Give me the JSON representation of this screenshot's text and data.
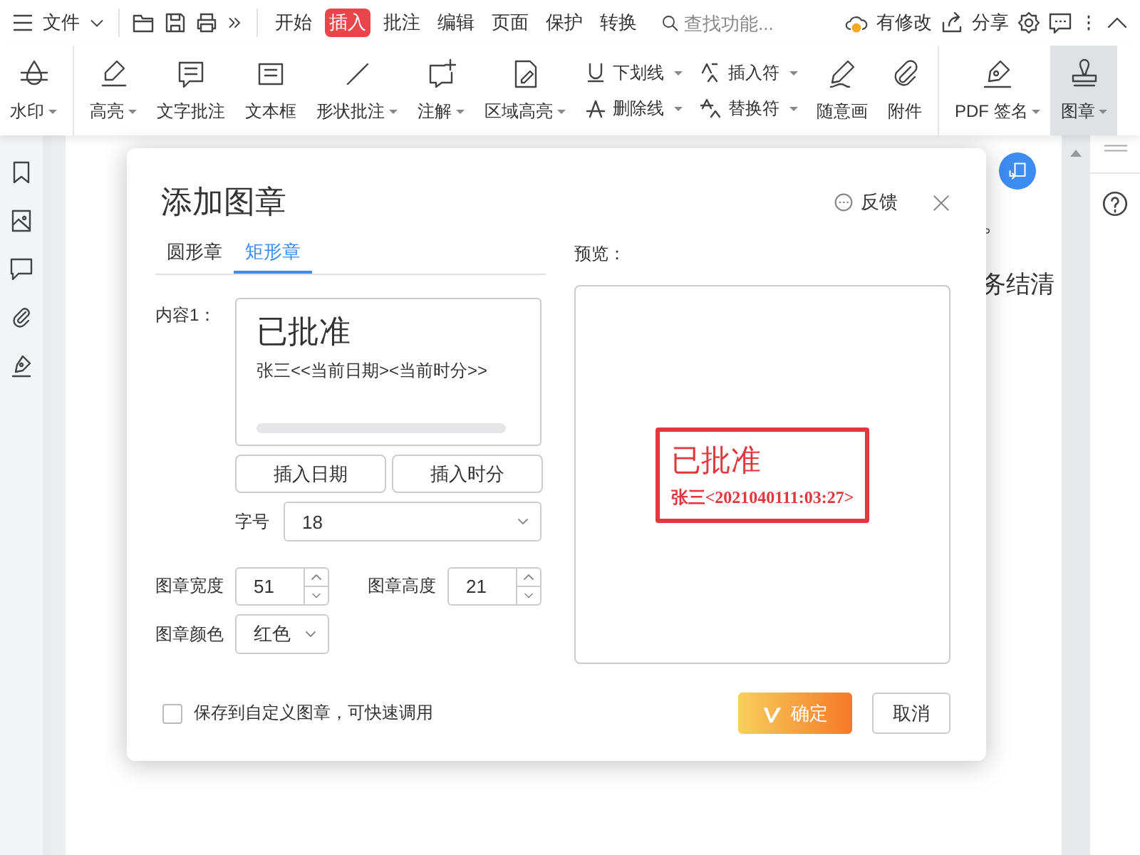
{
  "menubar": {
    "file_menu": "文件",
    "tabs": [
      {
        "label": "开始",
        "selected": false
      },
      {
        "label": "插入",
        "selected": true
      },
      {
        "label": "批注",
        "selected": false
      },
      {
        "label": "编辑",
        "selected": false
      },
      {
        "label": "页面",
        "selected": false
      },
      {
        "label": "保护",
        "selected": false
      },
      {
        "label": "转换",
        "selected": false
      }
    ],
    "search": {
      "placeholder": "查找功能..."
    },
    "sync_status": "有修改",
    "share": "分享"
  },
  "ribbon": {
    "groups": [
      [
        {
          "kind": "big",
          "label": "水印",
          "dropdown": true,
          "selected": false
        }
      ],
      [
        {
          "kind": "big",
          "label": "高亮",
          "dropdown": true,
          "selected": false
        },
        {
          "kind": "big",
          "label": "文字批注",
          "dropdown": false,
          "selected": false
        },
        {
          "kind": "big",
          "label": "文本框",
          "dropdown": false,
          "selected": false
        },
        {
          "kind": "big",
          "label": "形状批注",
          "dropdown": true,
          "selected": false
        },
        {
          "kind": "big",
          "label": "注解",
          "dropdown": true,
          "selected": false
        },
        {
          "kind": "big",
          "label": "区域高亮",
          "dropdown": true,
          "selected": false
        },
        {
          "kind": "pair",
          "rows": [
            {
              "label": "下划线",
              "dropdown": true
            },
            {
              "label": "删除线",
              "dropdown": true
            }
          ]
        },
        {
          "kind": "pair",
          "rows": [
            {
              "label": "插入符",
              "dropdown": true
            },
            {
              "label": "替换符",
              "dropdown": true
            }
          ]
        },
        {
          "kind": "big",
          "label": "随意画",
          "dropdown": false,
          "selected": false
        },
        {
          "kind": "big",
          "label": "附件",
          "dropdown": false,
          "selected": false
        }
      ],
      [
        {
          "kind": "big",
          "label": "PDF 签名",
          "dropdown": true,
          "selected": false
        },
        {
          "kind": "big",
          "label": "图章",
          "dropdown": true,
          "selected": true
        }
      ]
    ]
  },
  "document": {
    "lines": [
      "。",
      "务结清"
    ]
  },
  "dialog": {
    "title": "添加图章",
    "feedback": "反馈",
    "tabs": [
      {
        "label": "圆形章",
        "selected": false
      },
      {
        "label": "矩形章",
        "selected": true
      }
    ],
    "content_label": "内容1：",
    "content_lines": [
      "已批准",
      "张三<<当前日期><当前时分>>"
    ],
    "insert_buttons": [
      "插入日期",
      "插入时分"
    ],
    "font_size": {
      "label": "字号",
      "value": "18"
    },
    "stamp_width": {
      "label": "图章宽度",
      "value": "51"
    },
    "stamp_height": {
      "label": "图章高度",
      "value": "21"
    },
    "stamp_color": {
      "label": "图章颜色",
      "value": "红色"
    },
    "preview_label": "预览：",
    "stamp": {
      "title": "已批准",
      "subtitle": "张三<2021040111:03:27>"
    },
    "save_checkbox": {
      "label": "保存到自定义图章，可快速调用",
      "checked": false
    },
    "ok_button": "确定",
    "cancel_button": "取消"
  }
}
